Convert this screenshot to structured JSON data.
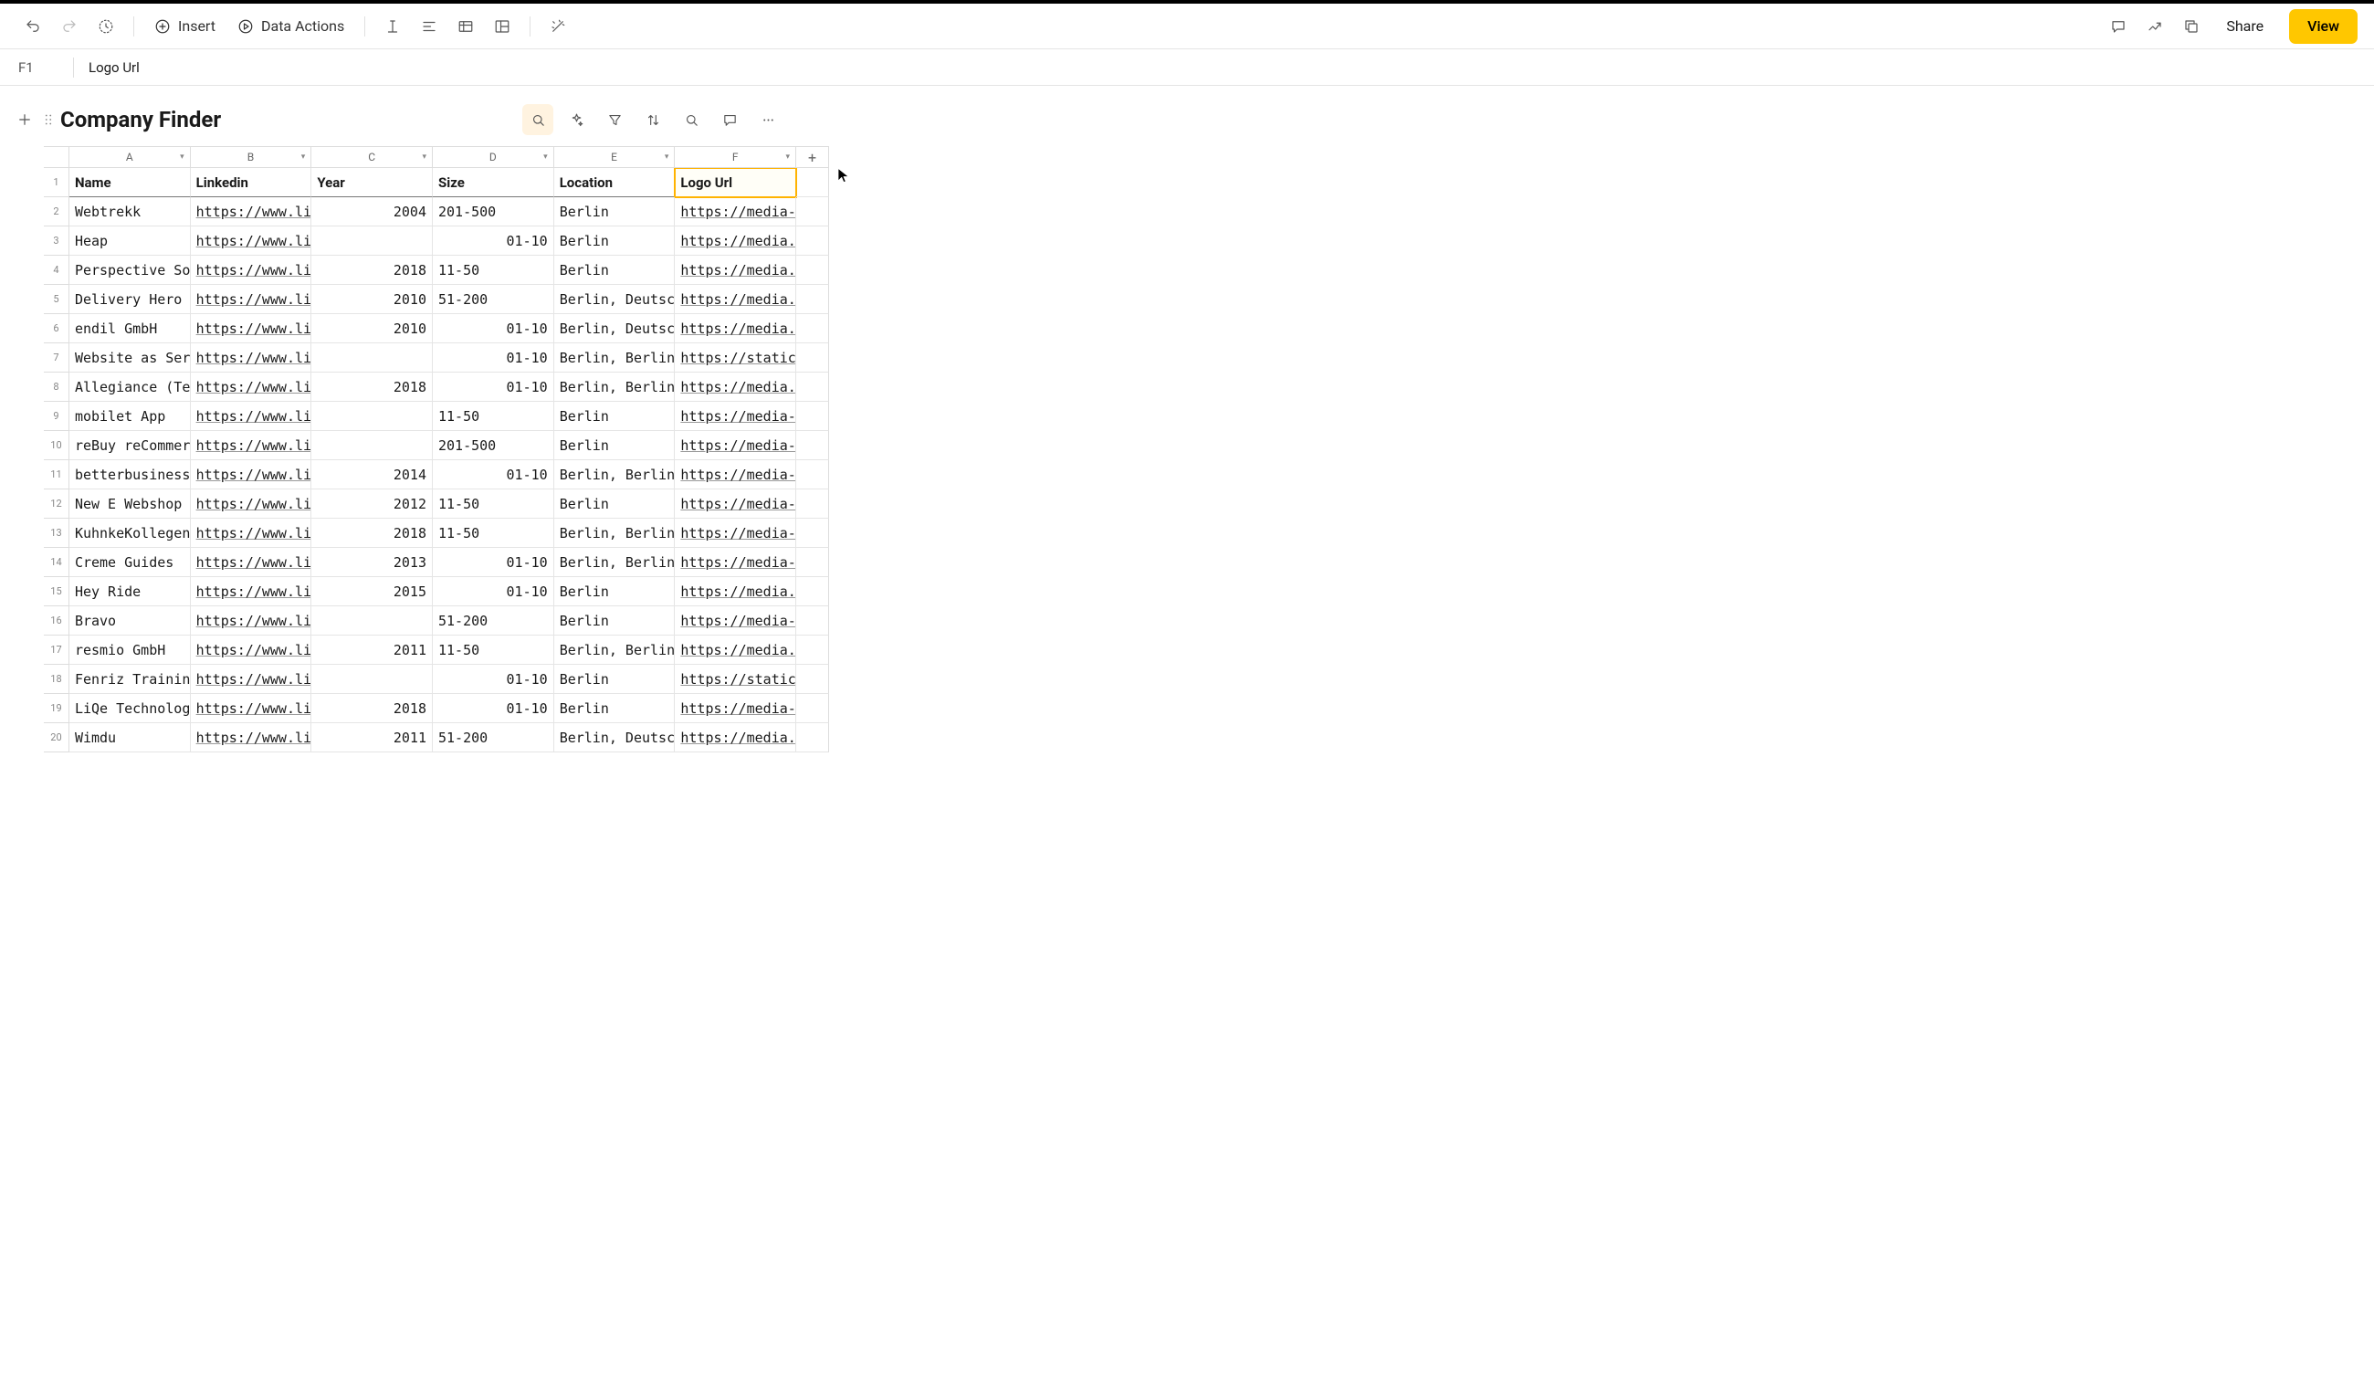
{
  "toolbar": {
    "insert_label": "Insert",
    "data_actions_label": "Data Actions",
    "share_label": "Share",
    "view_label": "View"
  },
  "formula_bar": {
    "active_cell": "F1",
    "content": "Logo Url"
  },
  "sheet": {
    "title": "Company Finder",
    "columns": [
      "A",
      "B",
      "C",
      "D",
      "E",
      "F"
    ],
    "headers": {
      "A": "Name",
      "B": "Linkedin",
      "C": "Year",
      "D": "Size",
      "E": "Location",
      "F": "Logo Url"
    },
    "selected_cell": "F1",
    "rows": [
      {
        "n": 2,
        "A": "Webtrekk",
        "B": "https://www.link",
        "C": "2004",
        "D": "201-500",
        "E": "Berlin",
        "F": "https://media-e"
      },
      {
        "n": 3,
        "A": "Heap",
        "B": "https://www.link",
        "C": "",
        "D": "01-10",
        "E": "Berlin",
        "F": "https://media.lic"
      },
      {
        "n": 4,
        "A": "Perspective Softw",
        "B": "https://www.link",
        "C": "2018",
        "D": "11-50",
        "E": "Berlin",
        "F": "https://media.lic"
      },
      {
        "n": 5,
        "A": "Delivery Hero Germ",
        "B": "https://www.link",
        "C": "2010",
        "D": "51-200",
        "E": "Berlin, Deutschlan",
        "F": "https://media.lic"
      },
      {
        "n": 6,
        "A": "endil GmbH",
        "B": "https://www.link",
        "C": "2010",
        "D": "01-10",
        "E": "Berlin, Deutschlan",
        "F": "https://media.lic"
      },
      {
        "n": 7,
        "A": "Website as Service",
        "B": "https://www.link",
        "C": "",
        "D": "01-10",
        "E": "Berlin, Berlin",
        "F": "https://static-ex"
      },
      {
        "n": 8,
        "A": "Allegiance (Techst",
        "B": "https://www.link",
        "C": "2018",
        "D": "01-10",
        "E": "Berlin, Berlin",
        "F": "https://media.lic"
      },
      {
        "n": 9,
        "A": "mobilet App",
        "B": "https://www.link",
        "C": "",
        "D": "11-50",
        "E": "Berlin",
        "F": "https://media-e"
      },
      {
        "n": 10,
        "A": "reBuy reCommerce",
        "B": "https://www.link",
        "C": "",
        "D": "201-500",
        "E": "Berlin",
        "F": "https://media-e"
      },
      {
        "n": 11,
        "A": "betterbusiness Gm",
        "B": "https://www.link",
        "C": "2014",
        "D": "01-10",
        "E": "Berlin, Berlin",
        "F": "https://media-e"
      },
      {
        "n": 12,
        "A": "New E Webshop",
        "B": "https://www.link",
        "C": "2012",
        "D": "11-50",
        "E": "Berlin",
        "F": "https://media-e"
      },
      {
        "n": 13,
        "A": "KuhnkeKollegen",
        "B": "https://www.link",
        "C": "2018",
        "D": "11-50",
        "E": "Berlin, Berlin",
        "F": "https://media-e"
      },
      {
        "n": 14,
        "A": "Creme Guides",
        "B": "https://www.link",
        "C": "2013",
        "D": "01-10",
        "E": "Berlin, Berlin",
        "F": "https://media-e"
      },
      {
        "n": 15,
        "A": "Hey Ride",
        "B": "https://www.link",
        "C": "2015",
        "D": "01-10",
        "E": "Berlin",
        "F": "https://media.lic"
      },
      {
        "n": 16,
        "A": "Bravo",
        "B": "https://www.link",
        "C": "",
        "D": "51-200",
        "E": "Berlin",
        "F": "https://media-e"
      },
      {
        "n": 17,
        "A": "resmio GmbH",
        "B": "https://www.link",
        "C": "2011",
        "D": "11-50",
        "E": "Berlin, Berlin",
        "F": "https://media.lic"
      },
      {
        "n": 18,
        "A": "Fenriz Training Cer",
        "B": "https://www.link",
        "C": "",
        "D": "01-10",
        "E": "Berlin",
        "F": "https://static-ex"
      },
      {
        "n": 19,
        "A": "LiQe Technologies",
        "B": "https://www.link",
        "C": "2018",
        "D": "01-10",
        "E": "Berlin",
        "F": "https://media-e"
      },
      {
        "n": 20,
        "A": "Wimdu",
        "B": "https://www.link",
        "C": "2011",
        "D": "51-200",
        "E": "Berlin, Deutschlan",
        "F": "https://media.lic"
      }
    ]
  }
}
